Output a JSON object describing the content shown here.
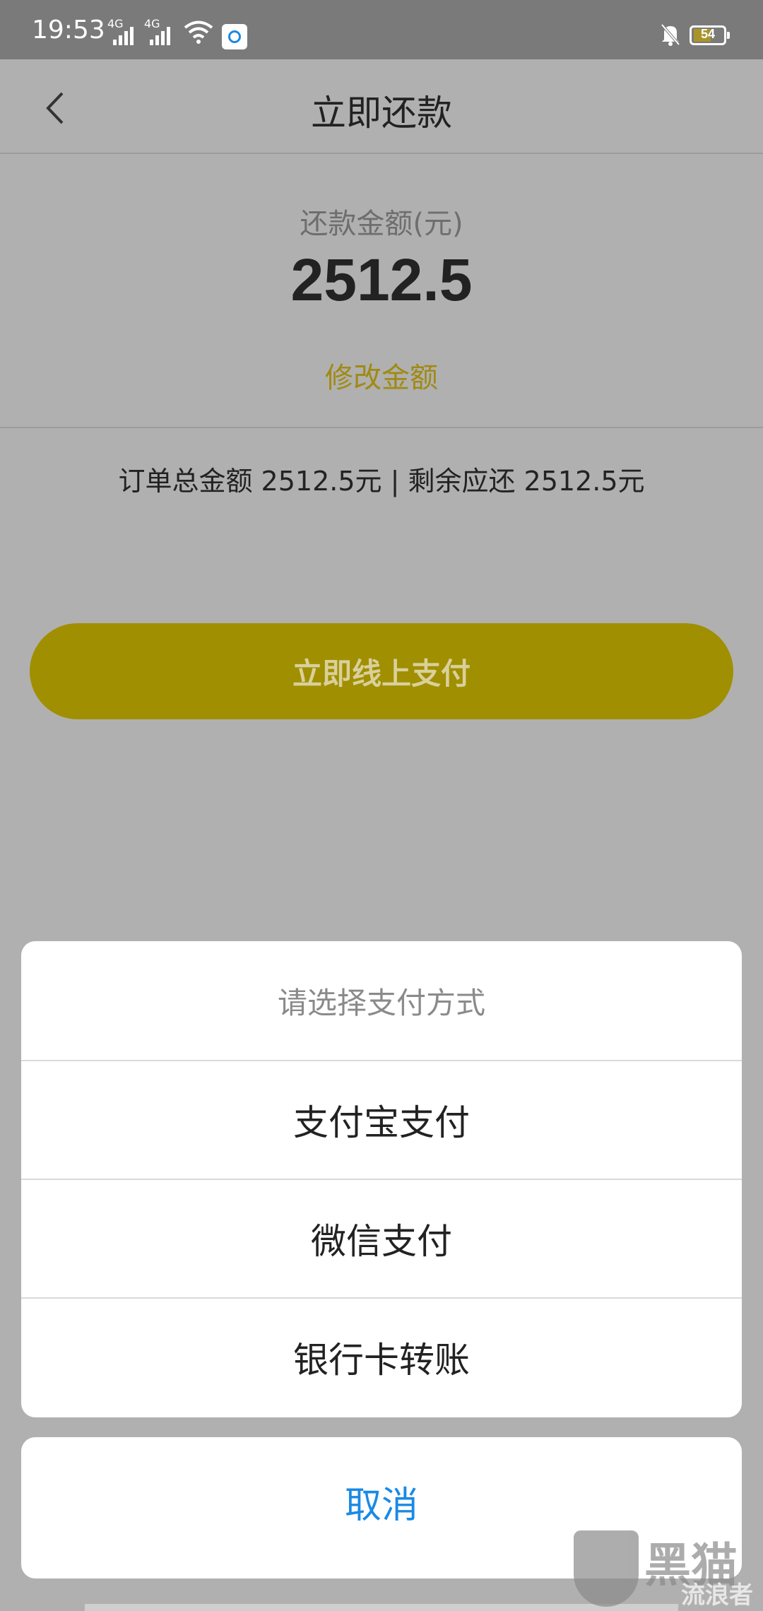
{
  "status_bar": {
    "time": "19:53",
    "network_1": "4G",
    "network_2": "4G",
    "battery": "54"
  },
  "nav": {
    "title": "立即还款"
  },
  "amount": {
    "label": "还款金额(元)",
    "value": "2512.5",
    "modify_label": "修改金额"
  },
  "summary": "订单总金额 2512.5元 | 剩余应还 2512.5元",
  "pay_button": "立即线上支付",
  "payment_sheet": {
    "title": "请选择支付方式",
    "options": [
      {
        "label": "支付宝支付"
      },
      {
        "label": "微信支付"
      },
      {
        "label": "银行卡转账"
      }
    ]
  },
  "cancel_label": "取消",
  "watermark": {
    "text_1": "黑猫",
    "text_2": "流浪者"
  },
  "colors": {
    "accent": "#a08f00",
    "link_gold": "#a08a12",
    "cancel_blue": "#1a8ae5",
    "overlay_gray": "#b0b0b0"
  }
}
